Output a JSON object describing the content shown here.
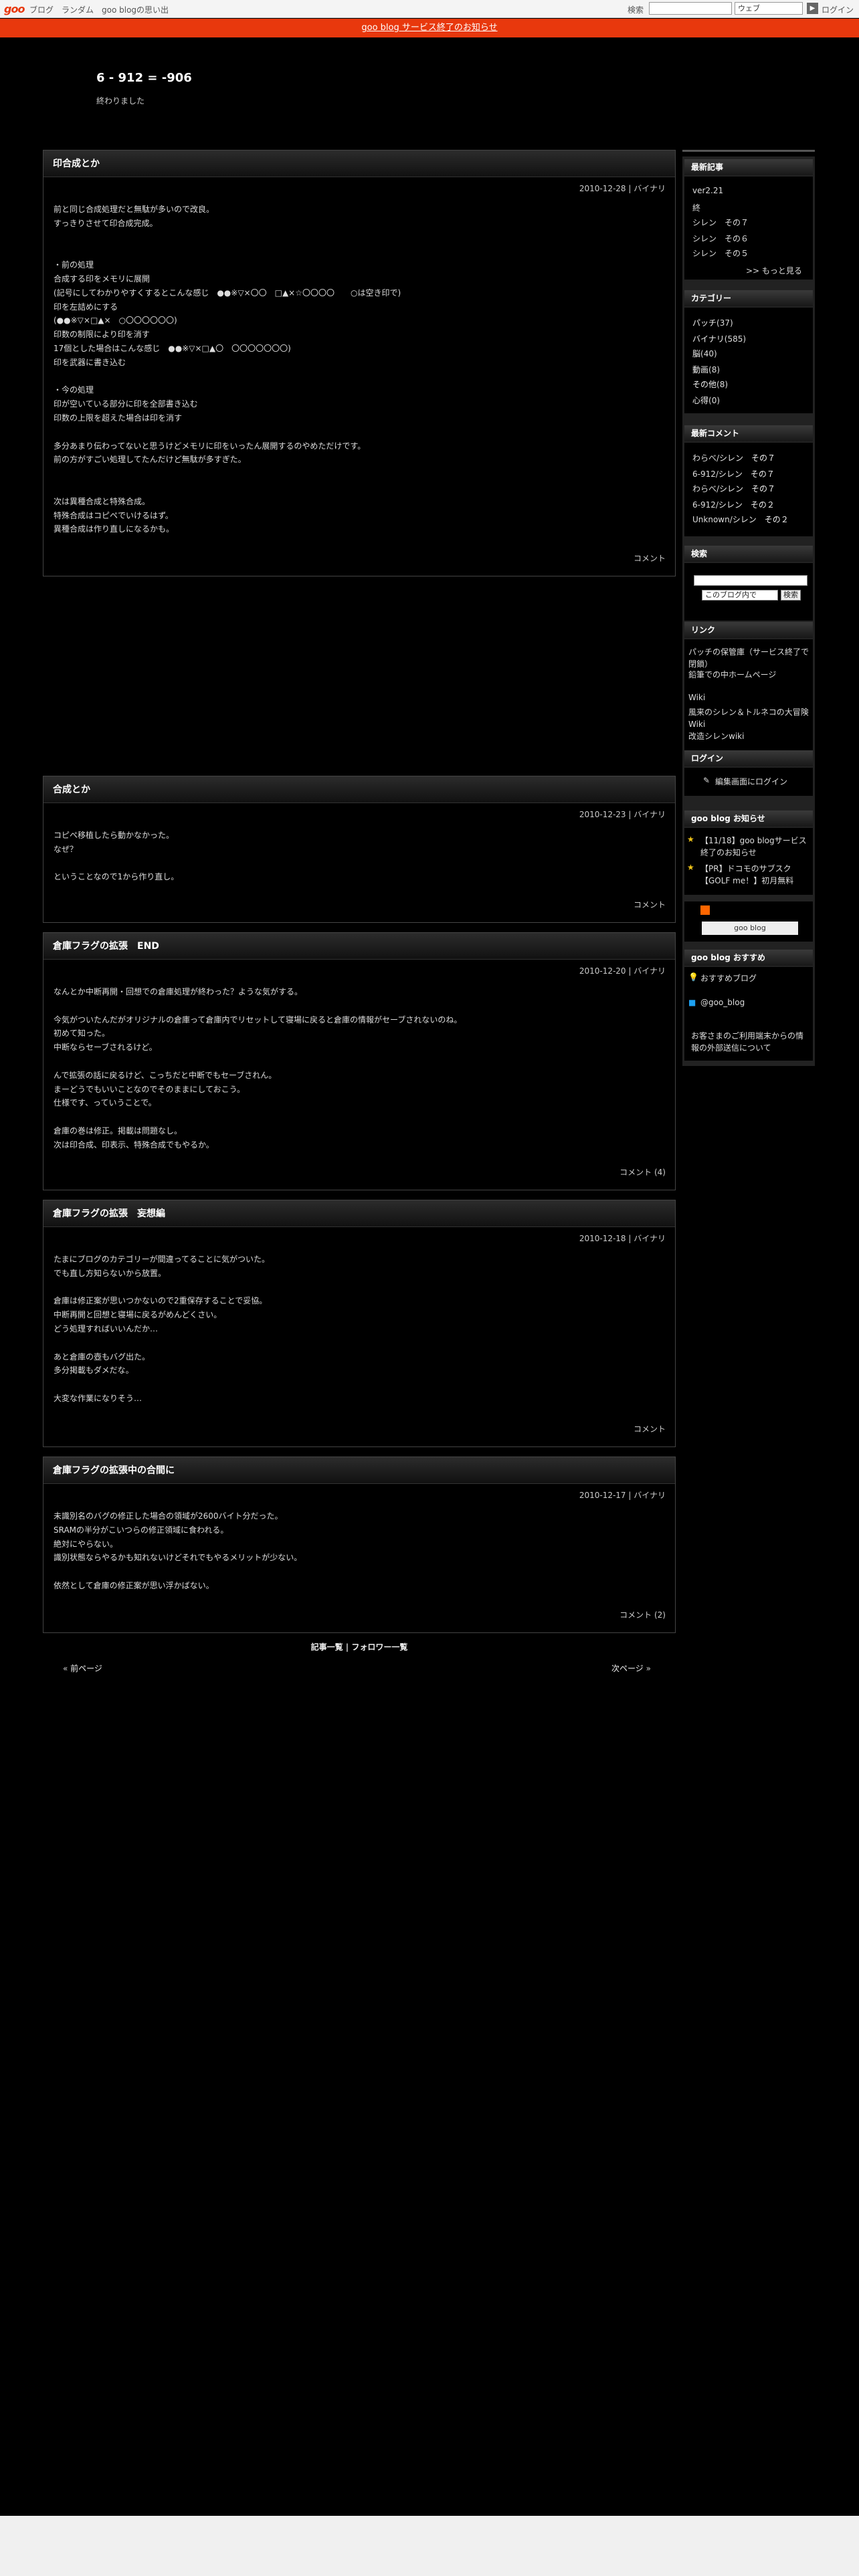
{
  "topbar": {
    "logo": "goo",
    "links": [
      "ブログ",
      "ランダム",
      "goo blogの思い出"
    ],
    "search_label": "検索",
    "search_select": "ウェブ",
    "login": "ログイン"
  },
  "notice": "goo blog サービス終了のお知らせ",
  "blog": {
    "title": "6 - 912 = -906",
    "desc": "終わりました"
  },
  "entries": [
    {
      "title": "印合成とか",
      "date": "2010-12-28 | バイナリ",
      "body": "前と同じ合成処理だと無駄が多いので改良。\nすっきりさせて印合成完成。\n\n\n・前の処理\n合成する印をメモリに展開\n(記号にしてわかりやすくするとこんな感じ　●●※▽×〇〇　□▲×☆〇〇〇〇　　○は空き印で)\n印を左詰めにする\n(●●※▽×□▲×　○〇〇〇〇〇〇)\n印数の制限により印を消す\n17個とした場合はこんな感じ　●●※▽×□▲〇　〇〇〇〇〇〇〇)\n印を武器に書き込む\n\n・今の処理\n印が空いている部分に印を全部書き込む\n印数の上限を超えた場合は印を消す\n\n多分あまり伝わってないと思うけどメモリに印をいったん展開するのやめただけです。\n前の方がすごい処理してたんだけど無駄が多すぎた。\n\n\n次は異種合成と特殊合成。\n特殊合成はコピペでいけるはず。\n異種合成は作り直しになるかも。",
      "comment": "コメント"
    },
    {
      "title": "合成とか",
      "date": "2010-12-23 | バイナリ",
      "body": "コピペ移植したら動かなかった。\nなぜ？\n\nということなので1から作り直し。",
      "comment": "コメント"
    },
    {
      "title": "倉庫フラグの拡張　END",
      "date": "2010-12-20 | バイナリ",
      "body": "なんとか中断再開・回想での倉庫処理が終わった？ような気がする。\n\n今気がついたんだがオリジナルの倉庫って倉庫内でリセットして寝場に戻ると倉庫の情報がセーブされないのね。\n初めて知った。\n中断ならセーブされるけど。\n\nんで拡張の話に戻るけど、こっちだと中断でもセーブされん。\nまーどうでもいいことなのでそのままにしておこう。\n仕様です、っていうことで。\n\n倉庫の巻は修正。掲載は問題なし。\n次は印合成、印表示、特殊合成でもやるか。",
      "comment": "コメント (4)"
    },
    {
      "title": "倉庫フラグの拡張　妄想編",
      "date": "2010-12-18 | バイナリ",
      "body": "たまにブログのカテゴリーが間違ってることに気がついた。\nでも直し方知らないから放置。\n\n倉庫は修正案が思いつかないので2重保存することで妥協。\n中断再開と回想と寝場に戻るがめんどくさい。\nどう処理すればいいんだか…\n\nあと倉庫の壺もバグ出た。\n多分掲載もダメだな。\n\n大変な作業になりそう…",
      "comment": "コメント"
    },
    {
      "title": "倉庫フラグの拡張中の合間に",
      "date": "2010-12-17 | バイナリ",
      "body": "未識別名のバグの修正した場合の領域が2600バイト分だった。\nSRAMの半分がこいつらの修正領域に食われる。\n絶対にやらない。\n識別状態ならやるかも知れないけどそれでもやるメリットが少ない。\n\n依然として倉庫の修正案が思い浮かばない。",
      "comment": "コメント (2)"
    }
  ],
  "pager": {
    "list": "記事一覧",
    "sep": " | ",
    "follower": "フォロワー一覧",
    "prev": "前ページ",
    "next": "次ページ",
    "prev_mark": "«",
    "next_mark": "»"
  },
  "sidebar": {
    "recent": {
      "title": "最新記事",
      "items": [
        "ver2.21",
        "終",
        "シレン　その７",
        "シレン　その６",
        "シレン　その５"
      ],
      "more": ">> もっと見る"
    },
    "cats": {
      "title": "カテゴリー",
      "items": [
        {
          "name": "パッチ",
          "count": "(37)"
        },
        {
          "name": "バイナリ",
          "count": "(585)"
        },
        {
          "name": "脳",
          "count": "(40)"
        },
        {
          "name": "動画",
          "count": "(8)"
        },
        {
          "name": "その他",
          "count": "(8)"
        },
        {
          "name": "心得",
          "count": "(0)"
        }
      ]
    },
    "comments": {
      "title": "最新コメント",
      "items": [
        {
          "who": "わらべ/",
          "link": "シレン　その７"
        },
        {
          "who": "6-912/",
          "link": "シレン　その７"
        },
        {
          "who": "わらべ/",
          "link": "シレン　その７"
        },
        {
          "who": "6-912/",
          "link": "シレン　その２"
        },
        {
          "who": "Unknown/",
          "link": "シレン　その２"
        }
      ]
    },
    "search": {
      "title": "検索",
      "select": "このブログ内で",
      "btn": "検索"
    },
    "links": {
      "title": "リンク",
      "l1": "パッチの保管庫（サービス終了で閉鎖）",
      "l2": "鉛筆での中ホームページ",
      "wiki": "Wiki",
      "l3": "風来のシレン＆トルネコの大冒険 Wiki",
      "l4": "改造シレンwiki"
    },
    "login": {
      "title": "ログイン",
      "link": "編集画面にログイン"
    },
    "news": {
      "title": "goo blog お知らせ",
      "items": [
        "【11/18】goo blogサービス終了のお知らせ",
        "【PR】ドコモのサブスク【GOLF me！】初月無料"
      ]
    },
    "rss": "RSS",
    "goo_btn": "goo blog",
    "recommend": {
      "title": "goo blog おすすめ",
      "link": "おすすめブログ",
      "twitter": "@goo_blog",
      "notice": "お客さまのご利用端末からの情報の外部送信について"
    }
  }
}
